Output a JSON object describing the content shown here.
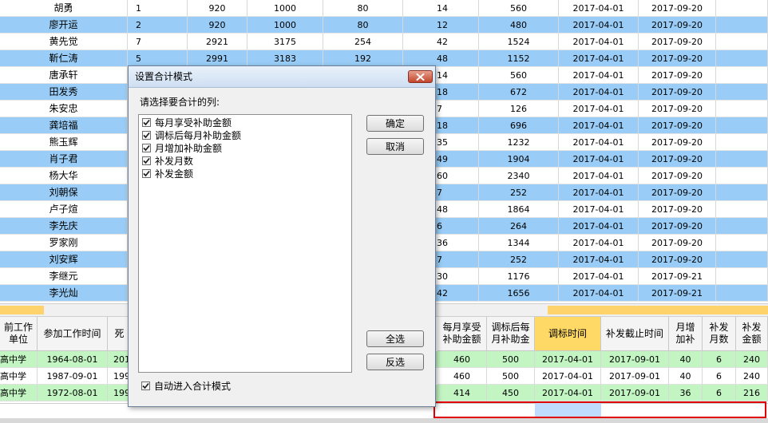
{
  "top_rows": [
    {
      "name": "胡勇",
      "a": "1",
      "b": "920",
      "c": "1000",
      "d": "80",
      "e": "14",
      "f": "560",
      "g": "2017-04-01",
      "h": "2017-09-20"
    },
    {
      "name": "廖开运",
      "a": "2",
      "b": "920",
      "c": "1000",
      "d": "80",
      "e": "12",
      "f": "480",
      "g": "2017-04-01",
      "h": "2017-09-20"
    },
    {
      "name": "黄先觉",
      "a": "7",
      "b": "2921",
      "c": "3175",
      "d": "254",
      "e": "42",
      "f": "1524",
      "g": "2017-04-01",
      "h": "2017-09-20"
    },
    {
      "name": "靳仁涛",
      "a": "5",
      "b": "2991",
      "c": "3183",
      "d": "192",
      "e": "48",
      "f": "1152",
      "g": "2017-04-01",
      "h": "2017-09-20"
    },
    {
      "name": "唐承轩",
      "a": "",
      "b": "",
      "c": "",
      "d": "",
      "e": "14",
      "f": "560",
      "g": "2017-04-01",
      "h": "2017-09-20"
    },
    {
      "name": "田发秀",
      "a": "",
      "b": "",
      "c": "",
      "d": "",
      "e": "18",
      "f": "672",
      "g": "2017-04-01",
      "h": "2017-09-20"
    },
    {
      "name": "朱安忠",
      "a": "",
      "b": "",
      "c": "",
      "d": "",
      "e": "7",
      "f": "126",
      "g": "2017-04-01",
      "h": "2017-09-20"
    },
    {
      "name": "龚培福",
      "a": "",
      "b": "",
      "c": "",
      "d": "",
      "e": "18",
      "f": "696",
      "g": "2017-04-01",
      "h": "2017-09-20"
    },
    {
      "name": "熊玉辉",
      "a": "",
      "b": "",
      "c": "",
      "d": "",
      "e": "35",
      "f": "1232",
      "g": "2017-04-01",
      "h": "2017-09-20"
    },
    {
      "name": "肖子君",
      "a": "",
      "b": "",
      "c": "",
      "d": "",
      "e": "49",
      "f": "1904",
      "g": "2017-04-01",
      "h": "2017-09-20"
    },
    {
      "name": "杨大华",
      "a": "",
      "b": "",
      "c": "",
      "d": "",
      "e": "60",
      "f": "2340",
      "g": "2017-04-01",
      "h": "2017-09-20"
    },
    {
      "name": "刘朝保",
      "a": "",
      "b": "",
      "c": "",
      "d": "",
      "e": "7",
      "f": "252",
      "g": "2017-04-01",
      "h": "2017-09-20"
    },
    {
      "name": "卢子煊",
      "a": "",
      "b": "",
      "c": "",
      "d": "",
      "e": "48",
      "f": "1864",
      "g": "2017-04-01",
      "h": "2017-09-20"
    },
    {
      "name": "李先庆",
      "a": "",
      "b": "",
      "c": "",
      "d": "",
      "e": "6",
      "f": "264",
      "g": "2017-04-01",
      "h": "2017-09-20"
    },
    {
      "name": "罗家刚",
      "a": "",
      "b": "",
      "c": "",
      "d": "",
      "e": "36",
      "f": "1344",
      "g": "2017-04-01",
      "h": "2017-09-20"
    },
    {
      "name": "刘安辉",
      "a": "",
      "b": "",
      "c": "",
      "d": "",
      "e": "7",
      "f": "252",
      "g": "2017-04-01",
      "h": "2017-09-20"
    },
    {
      "name": "李继元",
      "a": "",
      "b": "",
      "c": "",
      "d": "",
      "e": "30",
      "f": "1176",
      "g": "2017-04-01",
      "h": "2017-09-21"
    },
    {
      "name": "李光灿",
      "a": "",
      "b": "",
      "c": "",
      "d": "",
      "e": "42",
      "f": "1656",
      "g": "2017-04-01",
      "h": "2017-09-21"
    }
  ],
  "bottom_headers": {
    "unit": "前工作\n单位",
    "work_start": "参加工作时间",
    "death": "死",
    "r1": "每月享受\n补助金额",
    "r2": "调标后每\n月补助金",
    "r3": "调标时间",
    "r4": "补发截止时间",
    "r5": "月增\n加补",
    "r6": "补发\n月数",
    "r7": "补发\n金额"
  },
  "bottom_rows": [
    {
      "unit": "高中学",
      "work": "1964-08-01",
      "death": "201",
      "r1": "460",
      "r2": "500",
      "r3": "2017-04-01",
      "r4": "2017-09-01",
      "r5": "40",
      "r6": "6",
      "r7": "240"
    },
    {
      "unit": "高中学",
      "work": "1987-09-01",
      "death": "199",
      "r1": "460",
      "r2": "500",
      "r3": "2017-04-01",
      "r4": "2017-09-01",
      "r5": "40",
      "r6": "6",
      "r7": "240"
    },
    {
      "unit": "高中学",
      "work": "1972-08-01",
      "death": "199",
      "r1": "414",
      "r2": "450",
      "r3": "2017-04-01",
      "r4": "2017-09-01",
      "r5": "36",
      "r6": "6",
      "r7": "216"
    }
  ],
  "dialog": {
    "title": "设置合计模式",
    "prompt": "请选择要合计的列:",
    "items": [
      {
        "label": "每月享受补助金额",
        "checked": true
      },
      {
        "label": "调标后每月补助金额",
        "checked": true
      },
      {
        "label": "月增加补助金额",
        "checked": true
      },
      {
        "label": "补发月数",
        "checked": true
      },
      {
        "label": "补发金额",
        "checked": true
      }
    ],
    "ok_label": "确定",
    "cancel_label": "取消",
    "select_all_label": "全选",
    "invert_label": "反选",
    "auto_label": "自动进入合计模式",
    "auto_checked": true
  },
  "colors": {
    "row_blue": "#99cdf7",
    "row_green": "#c3f5c3",
    "selected_header": "#ffd966",
    "sum_highlight": "#e00000"
  }
}
